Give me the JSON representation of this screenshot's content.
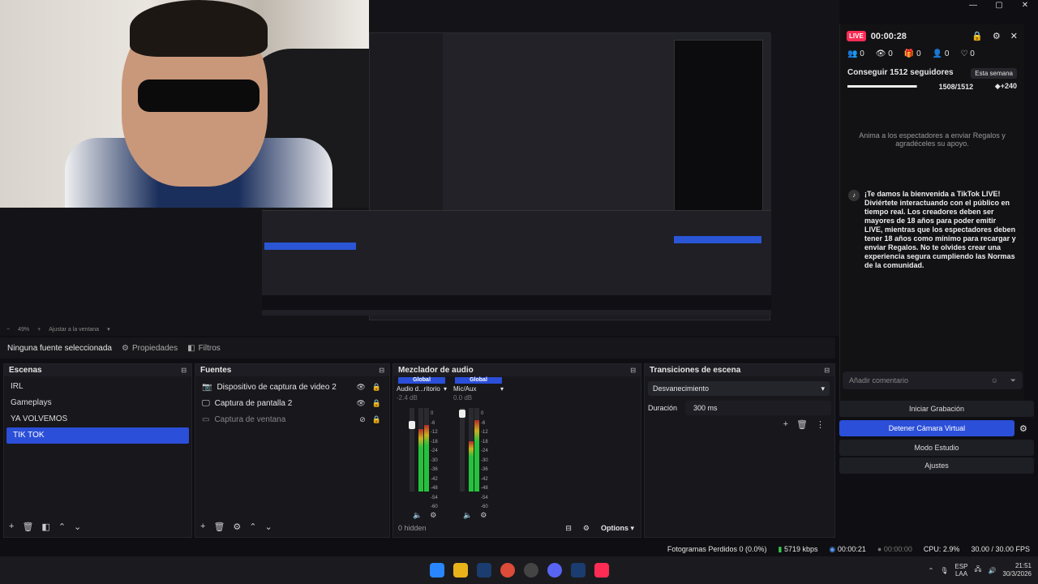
{
  "preview": {
    "zoom": "49%",
    "fit": "Ajustar a la ventana"
  },
  "source_bar": {
    "no_source": "Ninguna fuente seleccionada",
    "properties": "Propiedades",
    "filters": "Filtros"
  },
  "scenes": {
    "title": "Escenas",
    "items": [
      "IRL",
      "Gameplays",
      "YA VOLVEMOS",
      "TIK TOK"
    ]
  },
  "sources": {
    "title": "Fuentes",
    "items": [
      {
        "label": "Dispositivo de captura de video 2",
        "icon": "camera-icon"
      },
      {
        "label": "Captura de pantalla 2",
        "icon": "monitor-icon"
      },
      {
        "label": "Captura de ventana",
        "icon": "window-icon"
      }
    ]
  },
  "mixer": {
    "title": "Mezclador de audio",
    "channels": [
      {
        "global": "Global",
        "name": "Audio d...ritorio",
        "db": "-2.4 dB"
      },
      {
        "global": "Global",
        "name": "Mic/Aux",
        "db": "0.0 dB"
      }
    ],
    "scale": [
      "0",
      "-6",
      "-12",
      "-18",
      "-24",
      "-30",
      "-36",
      "-42",
      "-48",
      "-54",
      "-60"
    ],
    "hidden": "0 hidden",
    "options": "Options"
  },
  "transitions": {
    "title": "Transiciones de escena",
    "selected": "Desvanecimiento",
    "duration_label": "Duración",
    "duration_value": "300 ms"
  },
  "controls": {
    "start_recording": "Iniciar Grabación",
    "stop_virtual_cam": "Detener Cámara Virtual",
    "studio_mode": "Modo Estudio",
    "settings": "Ajustes"
  },
  "live": {
    "badge": "LIVE",
    "timer": "00:00:28",
    "stats": [
      "0",
      "0",
      "0",
      "0",
      "0"
    ],
    "goal_title": "Conseguir 1512 seguidores",
    "goal_period": "Esta semana",
    "goal_progress": "1508/1512",
    "goal_bonus": "+240",
    "goal_fraction": 0.997,
    "hint": "Anima a los espectadores a enviar Regalos y agradéceles su apoyo.",
    "welcome": "¡Te damos la bienvenida a TikTok LIVE! Diviértete interactuando con el público en tiempo real. Los creadores deben ser mayores de 18 años para poder emitir LIVE, mientras que los espectadores deben tener 18 años como mínimo para recargar y enviar Regalos. No te olvides crear una experiencia segura cumpliendo las Normas de la comunidad.",
    "comment_placeholder": "Añadir comentario"
  },
  "status": {
    "dropped": "Fotogramas Perdidos 0 (0.0%)",
    "bitrate": "5719 kbps",
    "stream_time": "00:00:21",
    "rec_time": "00:00:00",
    "cpu": "CPU: 2.9%",
    "fps": "30.00 / 30.00 FPS"
  },
  "taskbar": {
    "lang": "ESP",
    "lang2": "LAA",
    "time": "21:51",
    "date": "30/3/2026"
  }
}
